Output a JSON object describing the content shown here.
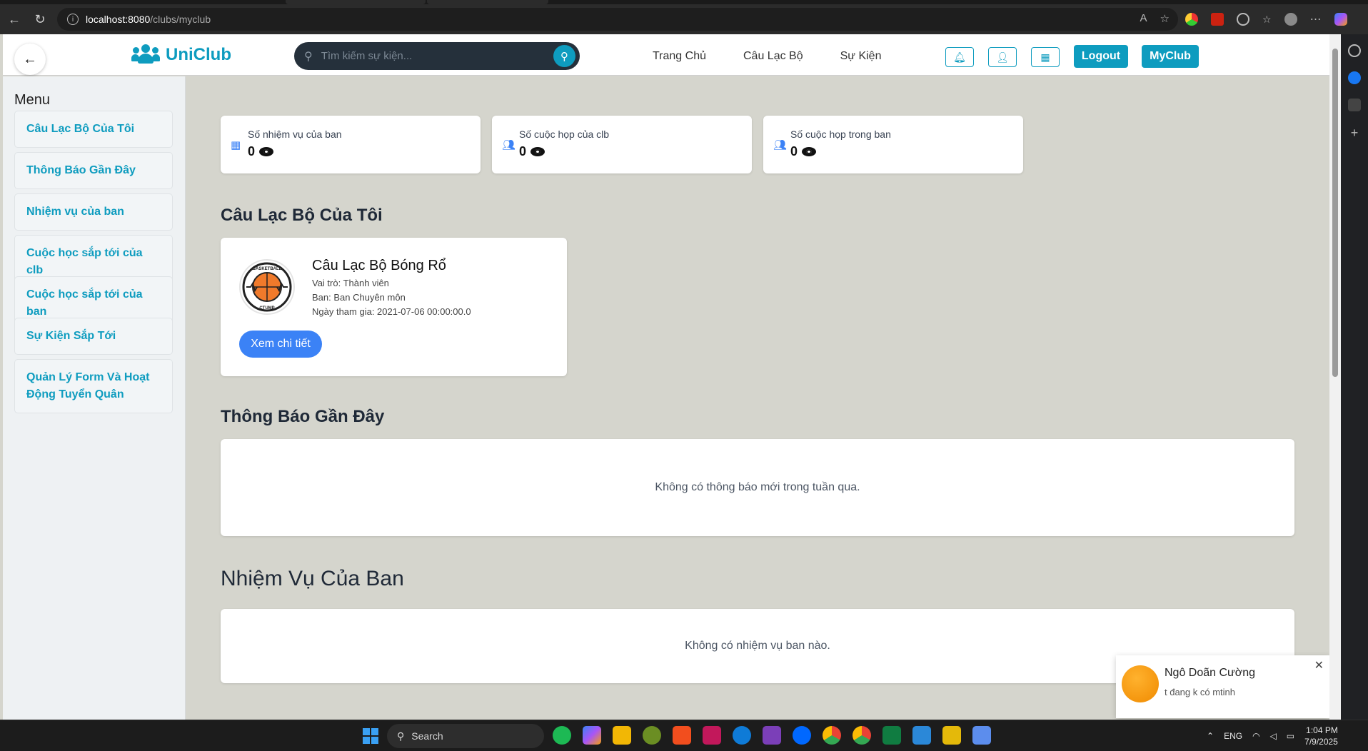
{
  "browser": {
    "url_host": "localhost:8080",
    "url_path": "/clubs/myclub"
  },
  "navbar": {
    "brand": "UniClub",
    "search_placeholder": "Tìm kiếm sự kiện...",
    "links": [
      "Trang Chủ",
      "Câu Lạc Bộ",
      "Sự Kiện"
    ],
    "logout_label": "Logout",
    "myclub_label": "MyClub",
    "icons": [
      "bell-icon",
      "user-icon",
      "calendar-icon"
    ]
  },
  "sidebar": {
    "title": "Menu",
    "items": [
      {
        "label": "Câu Lạc Bộ Của Tôi"
      },
      {
        "label": "Thông Báo Gần Đây"
      },
      {
        "label": "Nhiệm vụ của ban"
      },
      {
        "label": "Cuộc học sắp tới của clb"
      },
      {
        "label": "Cuộc học sắp tới của ban"
      },
      {
        "label": "Sự Kiện Sắp Tới"
      },
      {
        "label": "Quản Lý Form Và Hoạt Động Tuyển Quân"
      }
    ]
  },
  "stats": [
    {
      "label": "Số nhiệm vụ của ban",
      "value": "0",
      "icon": "calendar-icon"
    },
    {
      "label": "Số cuộc họp của clb",
      "value": "0",
      "icon": "users-icon"
    },
    {
      "label": "Số cuộc họp trong ban",
      "value": "0",
      "icon": "users-icon"
    }
  ],
  "my_clubs": {
    "title": "Câu Lạc Bộ Của Tôi",
    "club": {
      "name": "Câu Lạc Bộ Bóng Rổ",
      "role": "Vai trò: Thành viên",
      "department": "Ban: Ban Chuyên môn",
      "joined": "Ngày tham gia: 2021-07-06 00:00:00.0",
      "detail_button": "Xem chi tiết",
      "logo_text_top": "BASKETBALL",
      "logo_text_bottom": "CTUMP"
    }
  },
  "notifications": {
    "title": "Thông Báo Gần Đây",
    "empty": "Không có thông báo mới trong tuần qua."
  },
  "tasks": {
    "title": "Nhiệm Vụ Của Ban",
    "empty": "Không có nhiệm vụ ban nào."
  },
  "toast": {
    "name": "Ngô Doãn Cường",
    "message": "t đang k có mtinh"
  },
  "taskbar": {
    "search_label": "Search",
    "lang": "ENG",
    "time": "1:04 PM",
    "date": "7/9/2025"
  },
  "colors": {
    "accent": "#0e9cbf",
    "primary_button": "#3b82f6",
    "page_bg": "#d5d5cd"
  }
}
